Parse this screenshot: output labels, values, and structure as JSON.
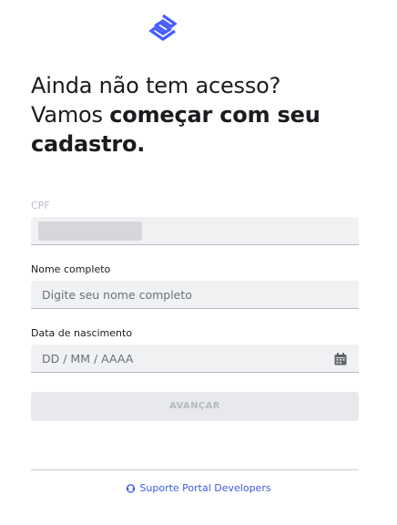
{
  "brand": {
    "logo_icon": "banco-do-brasil-logo-icon",
    "accent_color": "#465eff"
  },
  "heading": {
    "line1": "Ainda não tem acesso?",
    "line2_regular": "Vamos ",
    "line2_bold": "começar com seu",
    "line3_bold": "cadastro."
  },
  "form": {
    "cpf": {
      "label": "CPF",
      "value_masked": true,
      "disabled": true
    },
    "nome": {
      "label": "Nome completo",
      "placeholder": "Digite seu nome completo",
      "value": ""
    },
    "nascimento": {
      "label": "Data de nascimento",
      "placeholder": "DD / MM / AAAA",
      "value": "",
      "icon": "calendar-icon"
    },
    "submit": {
      "label": "AVANÇAR",
      "disabled": true
    }
  },
  "footer": {
    "support_label": "Suporte Portal Developers",
    "support_icon": "headset-icon",
    "link_color": "#3d5bd9"
  }
}
